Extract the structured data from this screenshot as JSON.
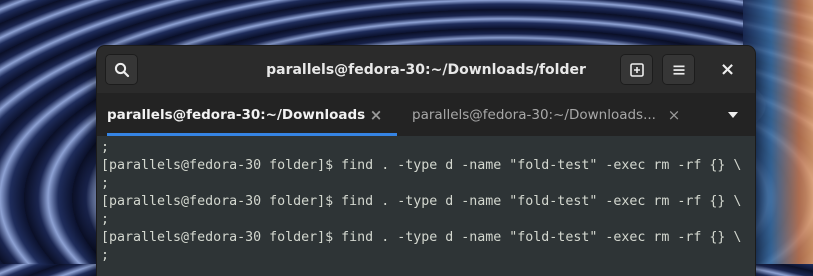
{
  "window": {
    "title": "parallels@fedora-30:~/Downloads/folder"
  },
  "header": {
    "search_icon": "search-icon",
    "new_tab_icon": "new-tab-icon",
    "menu_icon": "hamburger-menu-icon",
    "close_icon": "close-icon",
    "close_glyph": "×"
  },
  "tabs": [
    {
      "label": "parallels@fedora-30:~/Downloads...",
      "close": "×",
      "active": true
    },
    {
      "label": "parallels@fedora-30:~/Downloads...",
      "close": "×",
      "active": false
    }
  ],
  "tabbar": {
    "menu_icon": "chevron-down-icon"
  },
  "terminal": {
    "lines": [
      ";",
      "[parallels@fedora-30 folder]$ find . -type d -name \"fold-test\" -exec rm -rf {} \\",
      ";",
      "[parallels@fedora-30 folder]$ find . -type d -name \"fold-test\" -exec rm -rf {} \\",
      ";",
      "[parallels@fedora-30 folder]$ find . -type d -name \"fold-test\" -exec rm -rf {} \\",
      ";"
    ]
  },
  "colors": {
    "accent": "#3584e4",
    "terminal_bg": "#2e3436",
    "terminal_fg": "#d3d7cf",
    "headerbar_bg": "#2b2b2b"
  }
}
